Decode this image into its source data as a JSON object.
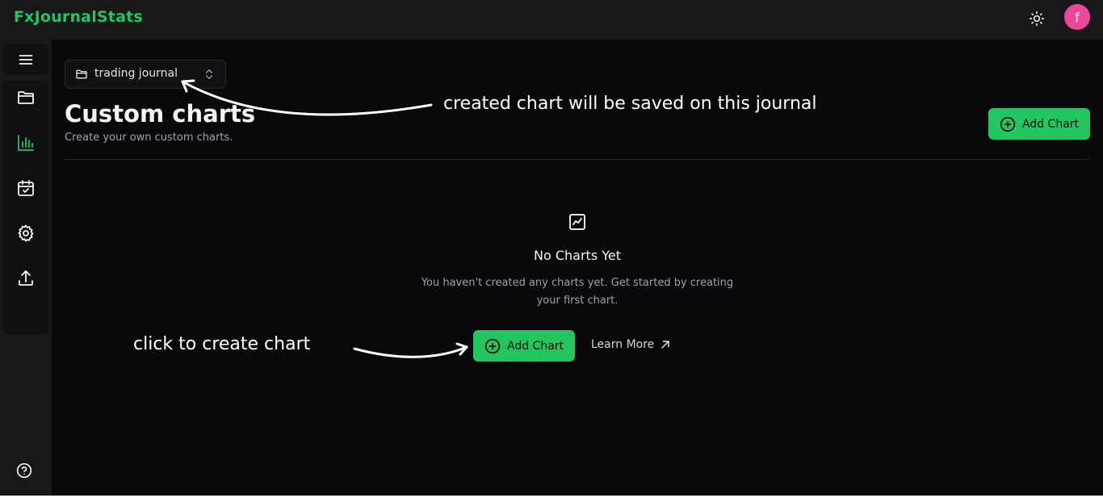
{
  "app": {
    "brand": "FxJournalStats",
    "avatar_letter": "f",
    "accent_color": "#22c55e",
    "avatar_color": "#ec4899"
  },
  "topbar": {
    "theme_icon": "sun-icon"
  },
  "sidebar": {
    "menu_icon": "hamburger-menu-icon",
    "items": [
      {
        "name": "journals",
        "icon": "folder-icon",
        "active": false
      },
      {
        "name": "charts",
        "icon": "bar-chart-icon",
        "active": true
      },
      {
        "name": "calendar",
        "icon": "calendar-check-icon",
        "active": false
      },
      {
        "name": "settings",
        "icon": "gear-icon",
        "active": false
      },
      {
        "name": "upload",
        "icon": "upload-icon",
        "active": false
      }
    ],
    "help_icon": "help-circle-icon"
  },
  "journal_selector": {
    "value": "trading journal"
  },
  "page": {
    "title": "Custom charts",
    "subtitle": "Create your own custom charts.",
    "add_button_label": "Add Chart"
  },
  "empty_state": {
    "icon": "line-chart-icon",
    "title": "No Charts Yet",
    "description": "You haven't created any charts yet. Get started by creating your first chart.",
    "add_button_label": "Add Chart",
    "learn_more_label": "Learn More"
  },
  "annotations": {
    "top": "created chart will be saved on this journal",
    "bottom": "click to create chart"
  }
}
